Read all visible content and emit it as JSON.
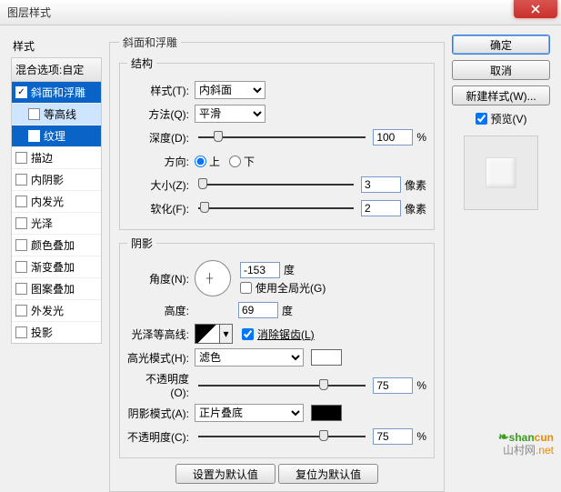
{
  "window": {
    "title": "图层样式"
  },
  "left": {
    "header": "样式",
    "blend": "混合选项:自定",
    "items": [
      {
        "label": "斜面和浮雕",
        "checked": true,
        "selected": true
      },
      {
        "label": "等高线",
        "checked": false,
        "sub": true
      },
      {
        "label": "纹理",
        "checked": false,
        "sub": true,
        "selected": true
      },
      {
        "label": "描边",
        "checked": false
      },
      {
        "label": "内阴影",
        "checked": false
      },
      {
        "label": "内发光",
        "checked": false
      },
      {
        "label": "光泽",
        "checked": false
      },
      {
        "label": "颜色叠加",
        "checked": false
      },
      {
        "label": "渐变叠加",
        "checked": false
      },
      {
        "label": "图案叠加",
        "checked": false
      },
      {
        "label": "外发光",
        "checked": false
      },
      {
        "label": "投影",
        "checked": false
      }
    ]
  },
  "bevel": {
    "group_title": "斜面和浮雕",
    "structure_title": "结构",
    "style_label": "样式(T):",
    "style_value": "内斜面",
    "technique_label": "方法(Q):",
    "technique_value": "平滑",
    "depth_label": "深度(D):",
    "depth_value": "100",
    "depth_unit": "%",
    "direction_label": "方向:",
    "up": "上",
    "down": "下",
    "size_label": "大小(Z):",
    "size_value": "3",
    "size_unit": "像素",
    "soften_label": "软化(F):",
    "soften_value": "2",
    "soften_unit": "像素",
    "shading_title": "阴影",
    "angle_label": "角度(N):",
    "angle_value": "-153",
    "angle_unit": "度",
    "global_label": "使用全局光(G)",
    "altitude_label": "高度:",
    "altitude_value": "69",
    "altitude_unit": "度",
    "gloss_label": "光泽等高线:",
    "antialias_label": "消除锯齿(L)",
    "highlight_mode_label": "高光模式(H):",
    "highlight_mode_value": "滤色",
    "highlight_opacity_label": "不透明度(O):",
    "highlight_opacity_value": "75",
    "highlight_opacity_unit": "%",
    "shadow_mode_label": "阴影模式(A):",
    "shadow_mode_value": "正片叠底",
    "shadow_opacity_label": "不透明度(C):",
    "shadow_opacity_value": "75",
    "shadow_opacity_unit": "%",
    "make_default": "设置为默认值",
    "reset_default": "复位为默认值"
  },
  "right": {
    "ok": "确定",
    "cancel": "取消",
    "new_style": "新建样式(W)...",
    "preview_label": "预览(V)"
  },
  "watermark": {
    "left": "shan",
    "right": "cun",
    "tld": ".net",
    "sub": "山村网"
  }
}
